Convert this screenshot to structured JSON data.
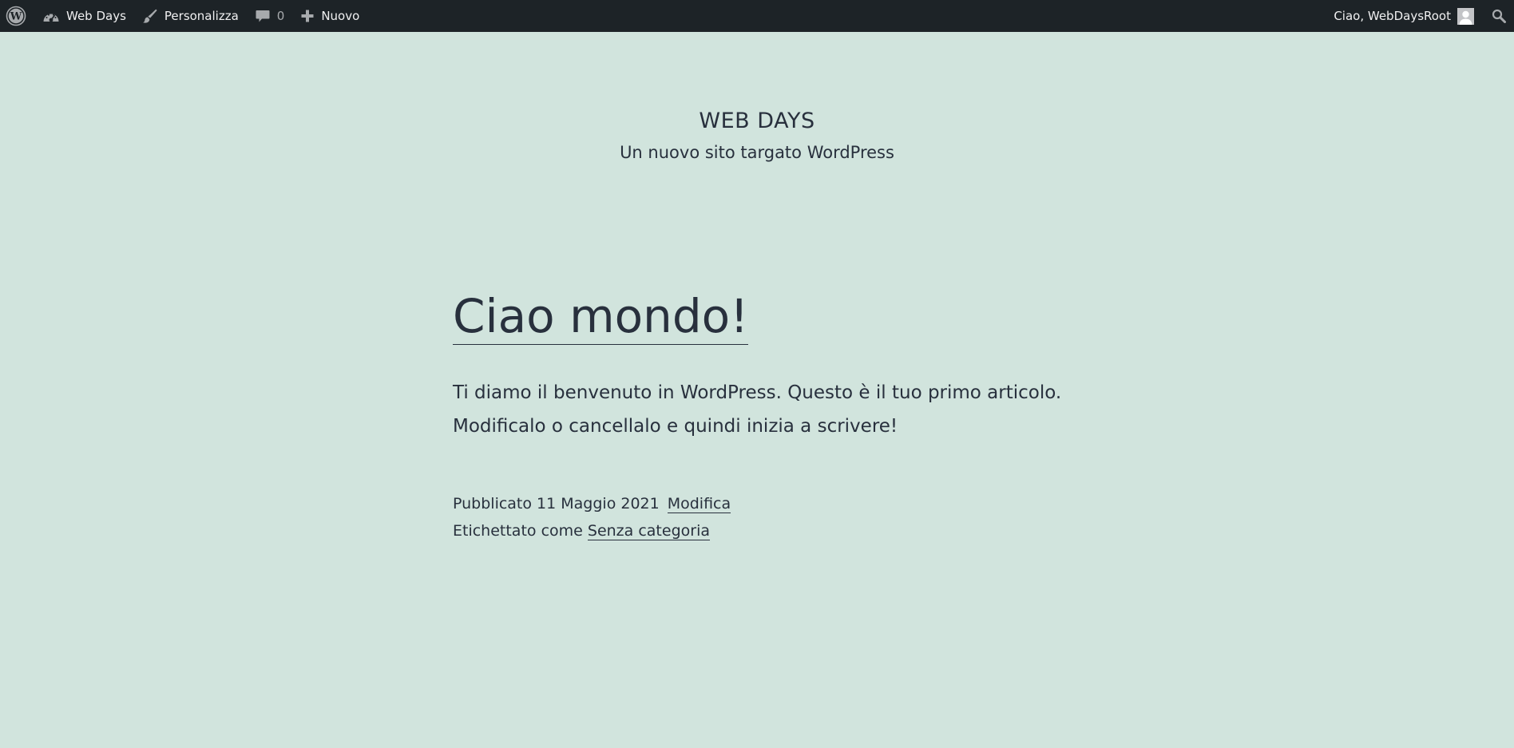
{
  "adminbar": {
    "site_name": "Web Days",
    "customize_label": "Personalizza",
    "comments_count": "0",
    "new_label": "Nuovo",
    "greeting": "Ciao, WebDaysRoot",
    "accent": "#72aee6",
    "bg": "#1d2327"
  },
  "header": {
    "site_title": "WEB DAYS",
    "tagline": "Un nuovo sito targato WordPress"
  },
  "post": {
    "title": "Ciao mondo!",
    "content_line1": "Ti diamo il benvenuto in WordPress. Questo è il tuo primo articolo.",
    "content_line2": "Modificalo o cancellalo e quindi inizia a scrivere!",
    "published_text": "Pubblicato 11 Maggio 2021",
    "edit_label": "Modifica",
    "tagged_text": "Etichettato come",
    "category_label": "Senza categoria"
  },
  "colors": {
    "page_background": "#d1e4dd",
    "text": "#28303d"
  },
  "icons": {
    "wp_logo": "wordpress-logo-icon",
    "dashboard": "dashboard-gauge-icon",
    "customize": "paintbrush-icon",
    "comments": "comment-bubble-icon",
    "new": "plus-icon",
    "avatar": "avatar-icon",
    "search": "search-icon"
  }
}
